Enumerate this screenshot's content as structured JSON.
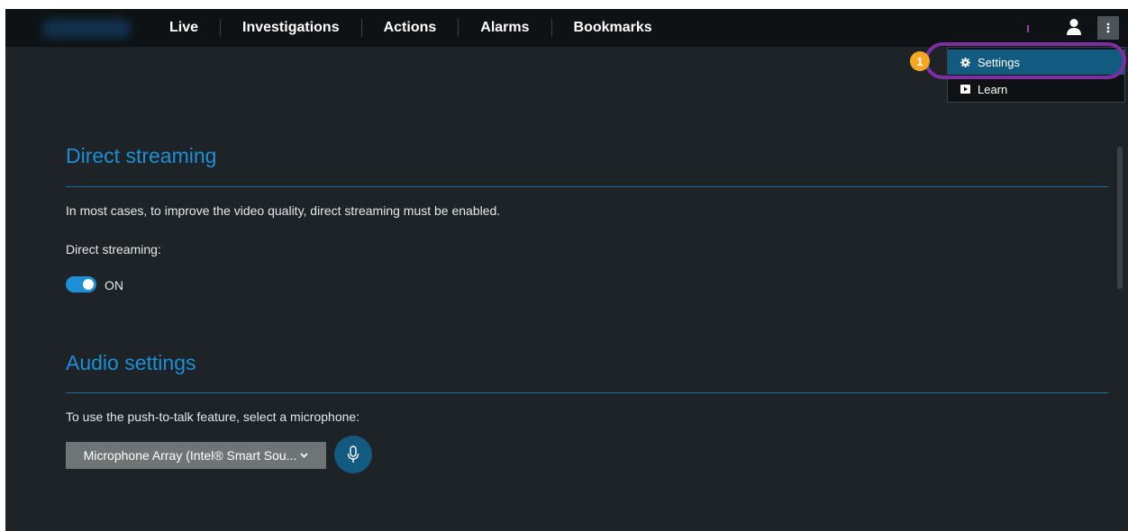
{
  "nav": {
    "items": [
      {
        "label": "Live"
      },
      {
        "label": "Investigations"
      },
      {
        "label": "Actions"
      },
      {
        "label": "Alarms"
      },
      {
        "label": "Bookmarks"
      }
    ]
  },
  "header_icons": {
    "user": "user-icon",
    "more": "vertical-ellipsis-icon"
  },
  "menu": {
    "items": [
      {
        "label": "Settings",
        "icon": "gear-icon",
        "selected": true
      },
      {
        "label": "Learn",
        "icon": "play-icon",
        "selected": false
      }
    ]
  },
  "annotation": {
    "badge": "1",
    "ring_color": "#7b2fa0",
    "badge_color": "#f5a623"
  },
  "direct_streaming": {
    "title": "Direct streaming",
    "description": "In most cases, to improve the video quality, direct streaming must be enabled.",
    "label": "Direct streaming:",
    "toggle_state": "ON"
  },
  "audio_settings": {
    "title": "Audio settings",
    "description": "To use the push-to-talk feature, select a microphone:",
    "selected_microphone": "Microphone Array (Intel® Smart Sou...",
    "mic_icon": "microphone-icon"
  },
  "colors": {
    "accent": "#1c8fd6",
    "background": "#1d2326",
    "topbar": "#0e1214",
    "menu_selected": "#135a80"
  }
}
